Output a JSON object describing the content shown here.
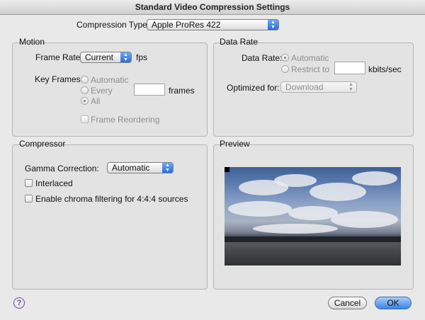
{
  "window": {
    "title": "Standard Video Compression Settings"
  },
  "compression_type": {
    "label": "Compression Type:",
    "value": "Apple ProRes 422"
  },
  "motion": {
    "title": "Motion",
    "frame_rate_label": "Frame Rate:",
    "frame_rate_value": "Current",
    "frame_rate_unit": "fps",
    "key_frames_label": "Key Frames:",
    "key_frames_options": [
      "Automatic",
      "Every",
      "All"
    ],
    "key_frames_selected": "All",
    "frames_unit": "frames",
    "frame_reordering_label": "Frame Reordering"
  },
  "data_rate": {
    "title": "Data Rate",
    "label": "Data Rate:",
    "options": [
      "Automatic",
      "Restrict to"
    ],
    "selected": "Automatic",
    "unit": "kbits/sec",
    "optimized_label": "Optimized for:",
    "optimized_value": "Download"
  },
  "compressor": {
    "title": "Compressor",
    "gamma_label": "Gamma Correction:",
    "gamma_value": "Automatic",
    "interlaced_label": "Interlaced",
    "chroma_label": "Enable chroma filtering for 4:4:4 sources"
  },
  "preview": {
    "title": "Preview"
  },
  "buttons": {
    "help": "?",
    "cancel": "Cancel",
    "ok": "OK"
  },
  "icons": {
    "popup": "up-down-arrows-icon",
    "help": "question-mark-icon"
  }
}
